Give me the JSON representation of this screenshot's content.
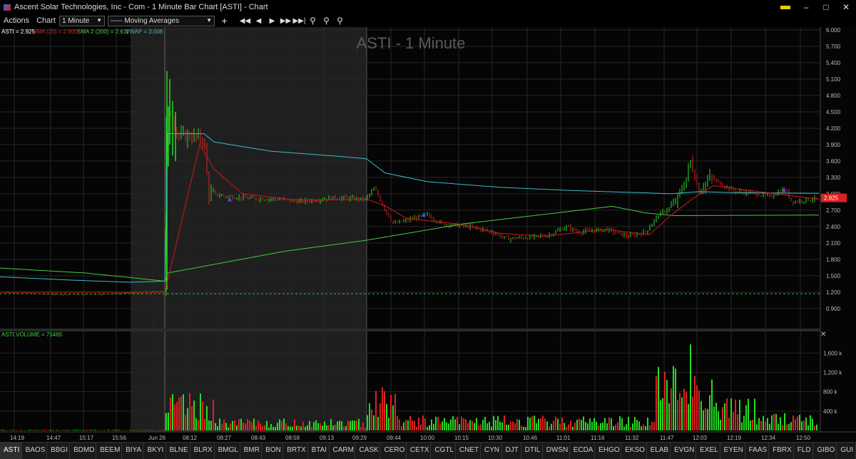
{
  "window": {
    "title": "Ascent Solar Technologies, Inc - Com - 1 Minute Bar Chart [ASTI] - Chart",
    "minimize": "–",
    "maximize": "□",
    "close": "✕"
  },
  "toolbar": {
    "menu_actions": "Actions",
    "menu_chart": "Chart",
    "interval": "1 Minute",
    "studies": "----- Moving Averages",
    "plus": "+",
    "nav": [
      "◀◀",
      "◀",
      "▶",
      "▶▶",
      "▶▶|"
    ],
    "icons": [
      "zoom-icon",
      "zoom-in-icon",
      "zoom-out-icon"
    ]
  },
  "chart": {
    "watermark": "ASTI - 1 Minute",
    "legend": {
      "price": "ASTI = 2.925",
      "sma1": "SMA (20) = 2.900",
      "sma2": "SMA 2 (200) = 2.611",
      "vwap": "VWAP = 3.008"
    },
    "price_axis": [
      "6.000",
      "5.700",
      "5.400",
      "5.100",
      "4.800",
      "4.500",
      "4.200",
      "3.900",
      "3.600",
      "3.300",
      "3.000",
      "2.700",
      "2.400",
      "2.100",
      "1.800",
      "1.500",
      "1.200",
      "0.900"
    ],
    "current_price": "2.925",
    "volume_label": "ASTI.VOLUME = 75465",
    "volume_axis": [
      "1,600 k",
      "1,200 k",
      "800 k",
      "400 k"
    ],
    "time_axis": [
      "14:19",
      "14:47",
      "15:17",
      "15:56",
      "Jun 26",
      "08:12",
      "08:27",
      "08:43",
      "08:58",
      "09:13",
      "09:29",
      "09:44",
      "10:00",
      "10:15",
      "10:30",
      "10:46",
      "11:01",
      "11:16",
      "11:32",
      "11:47",
      "12:03",
      "12:19",
      "12:34",
      "12:50"
    ],
    "colors": {
      "up": "#22dd22",
      "down": "#e02020",
      "vwap": "#3fb8c8",
      "sma200": "#44cc44",
      "sma20": "#d01818",
      "marker": "#3355ff"
    }
  },
  "chart_data": {
    "type": "bar",
    "symbol": "ASTI",
    "interval": "1 Minute",
    "price_range": [
      0.65,
      6.0
    ],
    "current_price": 2.925,
    "support_line": 1.17,
    "series": [
      {
        "name": "SMA (20)",
        "last": 2.9
      },
      {
        "name": "SMA 2 (200)",
        "last": 2.611
      },
      {
        "name": "VWAP",
        "last": 3.008
      }
    ],
    "volume_last": 75465,
    "volume_range": [
      0,
      1900
    ]
  },
  "tabs": [
    "ASTI",
    "BAOS",
    "BBGI",
    "BDMD",
    "BEEM",
    "BIYA",
    "BKYI",
    "BLNE",
    "BLRX",
    "BMGL",
    "BMR",
    "BON",
    "BRTX",
    "BTAI",
    "CARM",
    "CASK",
    "CERO",
    "CETX",
    "CGTL",
    "CNET",
    "CYN",
    "DJT",
    "DTIL",
    "DWSN",
    "ECDA",
    "EHGO",
    "EKSO",
    "ELAB",
    "EVGN",
    "EXEL",
    "EYEN",
    "FAAS",
    "FBRX",
    "FLD",
    "GIBO",
    "GUI"
  ]
}
